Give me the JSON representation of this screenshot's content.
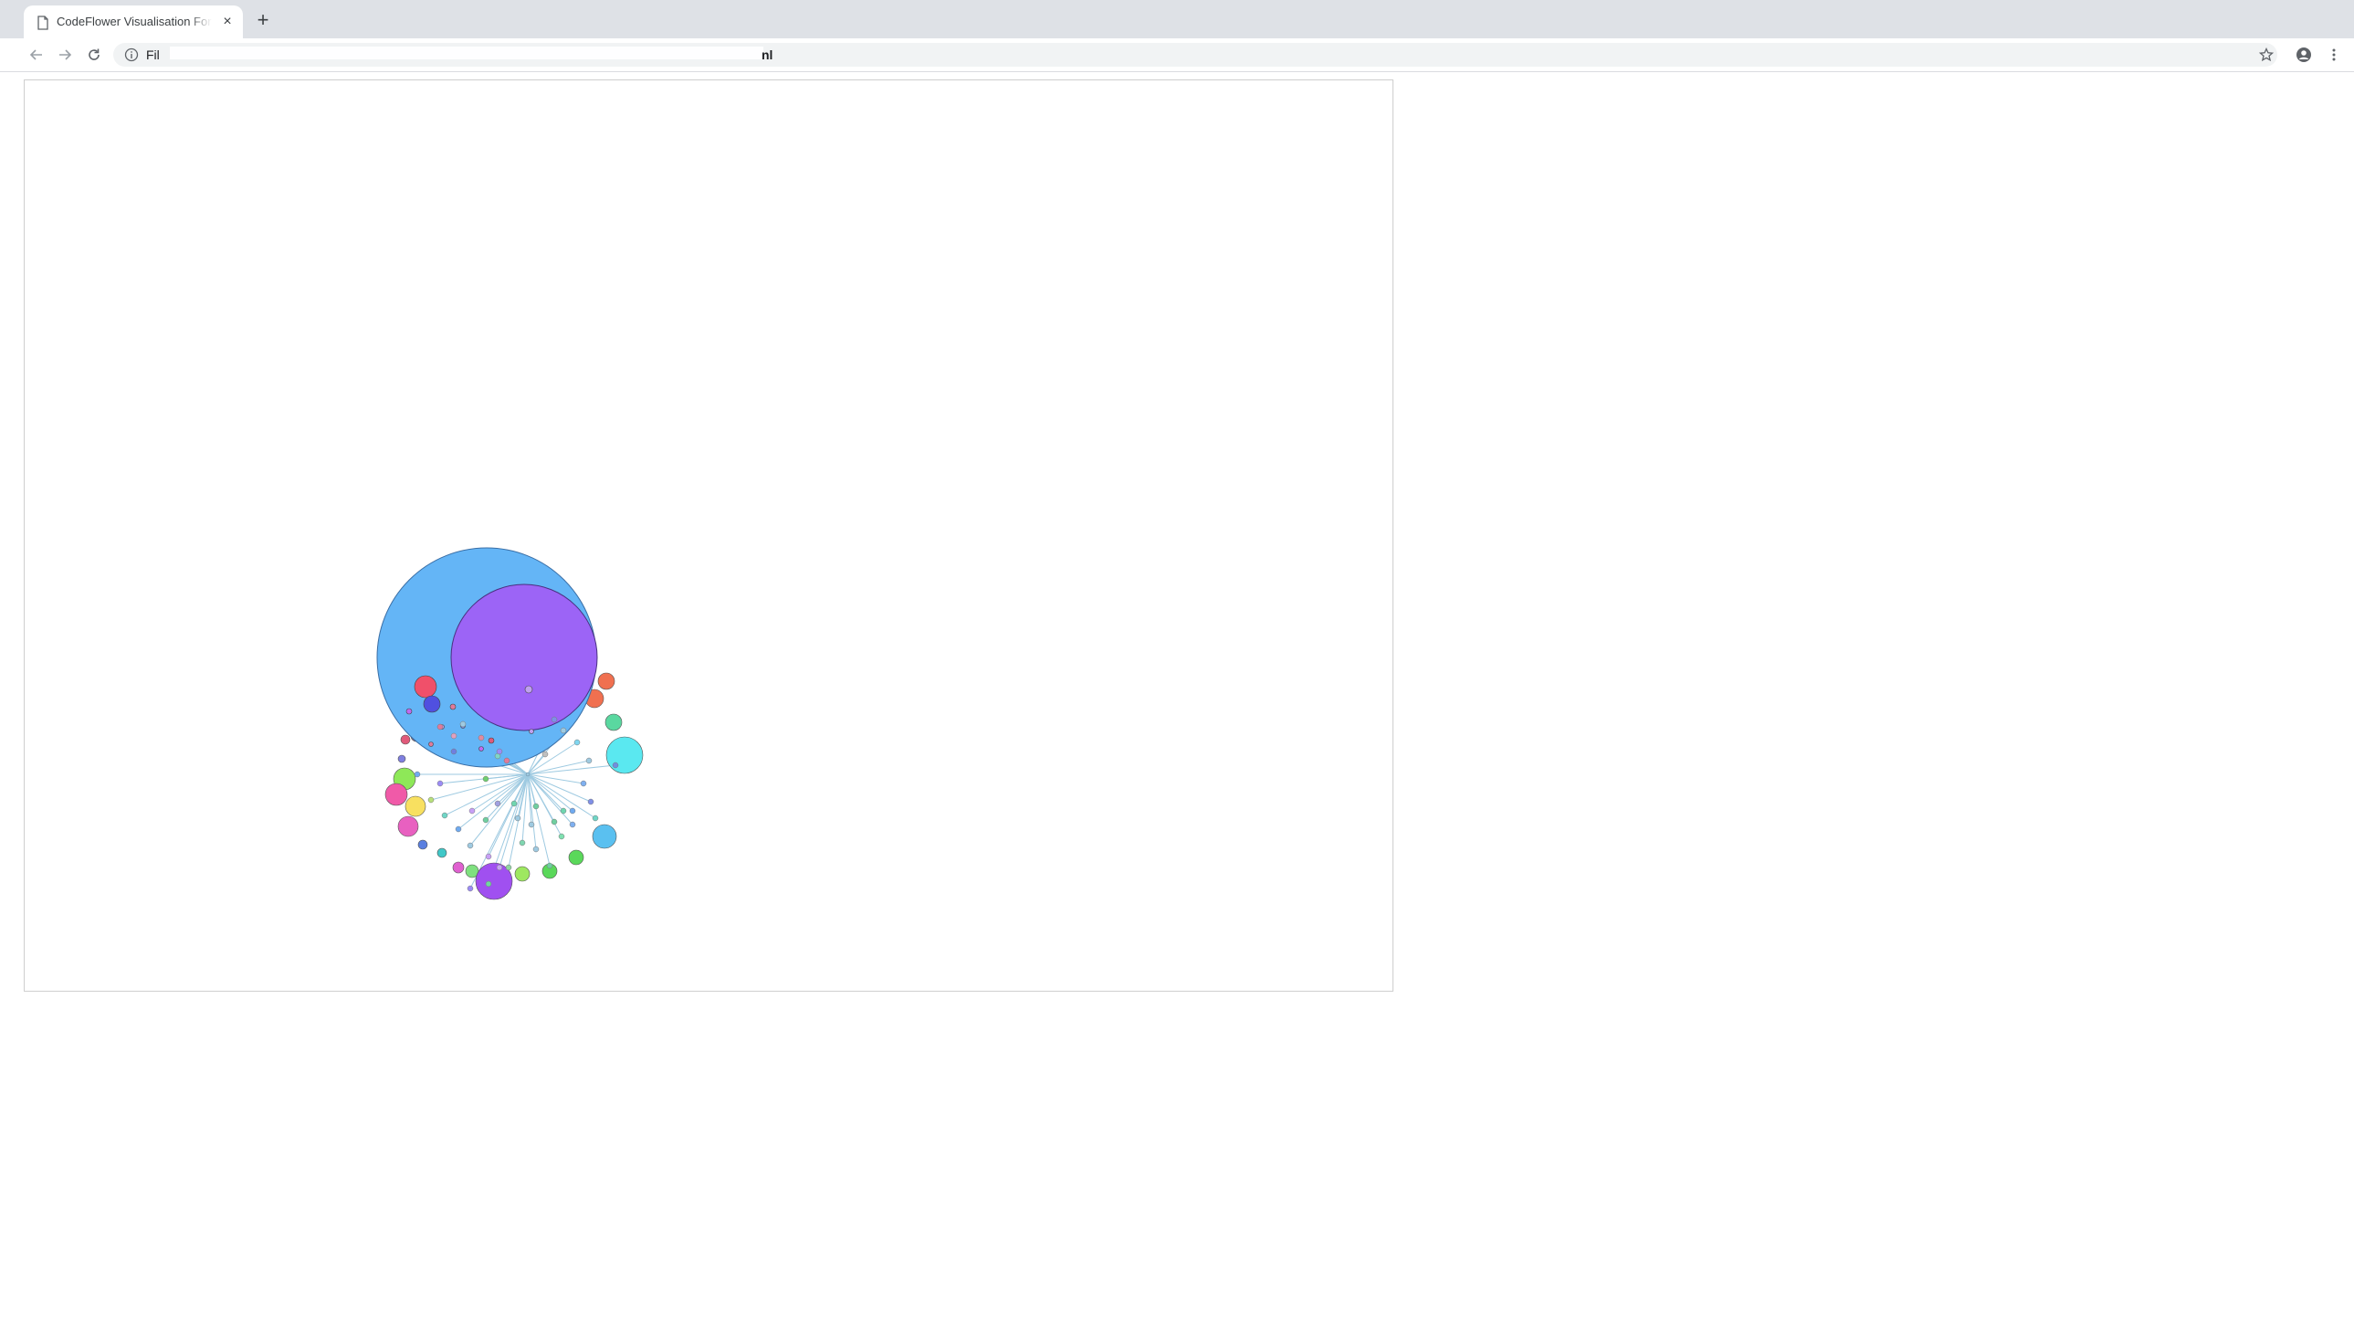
{
  "tab": {
    "title": "CodeFlower Visualisation For P",
    "favicon": "page-icon",
    "close_label": "×"
  },
  "new_tab_label": "+",
  "toolbar": {
    "back_icon": "back-arrow-icon",
    "forward_icon": "forward-arrow-icon",
    "reload_icon": "reload-icon",
    "star_icon": "star-icon",
    "profile_icon": "profile-icon",
    "menu_icon": "kebab-menu-icon"
  },
  "omnibox": {
    "info_icon": "info-icon",
    "prefix": "Fil",
    "suffix": "nl"
  },
  "codeflower": {
    "colors": {
      "root_cluster": "#64b5f6",
      "purple": "#9c64f6",
      "edge": "#9ecae1"
    }
  }
}
